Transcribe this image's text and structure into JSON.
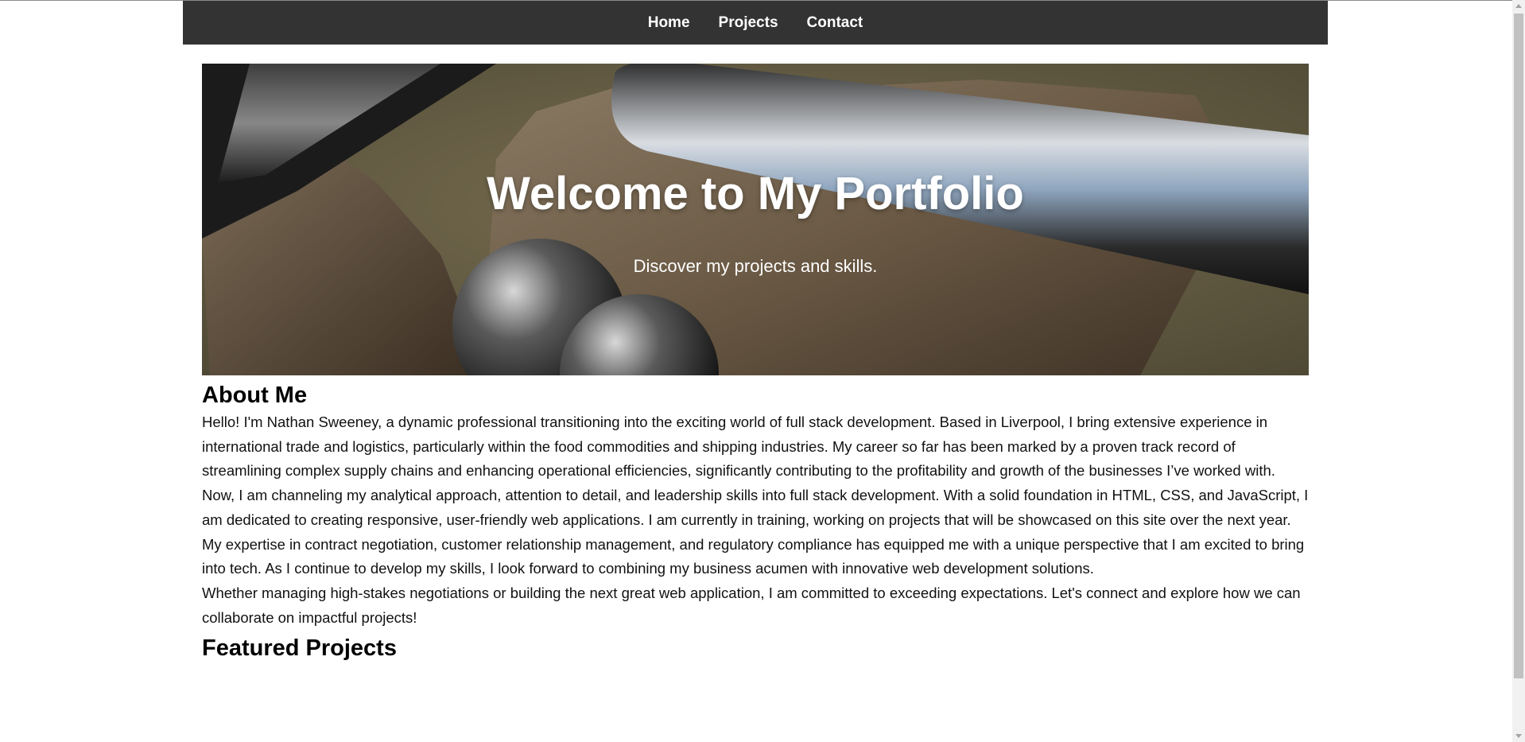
{
  "nav": {
    "items": [
      "Home",
      "Projects",
      "Contact"
    ]
  },
  "hero": {
    "title": "Welcome to My Portfolio",
    "subtitle": "Discover my projects and skills."
  },
  "about": {
    "heading": "About Me",
    "paragraphs": [
      "Hello! I'm Nathan Sweeney, a dynamic professional transitioning into the exciting world of full stack development. Based in Liverpool, I bring extensive experience in international trade and logistics, particularly within the food commodities and shipping industries. My career so far has been marked by a proven track record of streamlining complex supply chains and enhancing operational efficiencies, significantly contributing to the profitability and growth of the businesses I’ve worked with.",
      "Now, I am channeling my analytical approach, attention to detail, and leadership skills into full stack development. With a solid foundation in HTML, CSS, and JavaScript, I am dedicated to creating responsive, user-friendly web applications. I am currently in training, working on projects that will be showcased on this site over the next year.",
      "My expertise in contract negotiation, customer relationship management, and regulatory compliance has equipped me with a unique perspective that I am excited to bring into tech. As I continue to develop my skills, I look forward to combining my business acumen with innovative web development solutions.",
      "Whether managing high-stakes negotiations or building the next great web application, I am committed to exceeding expectations. Let's connect and explore how we can collaborate on impactful projects!"
    ]
  },
  "projects": {
    "heading": "Featured Projects"
  }
}
